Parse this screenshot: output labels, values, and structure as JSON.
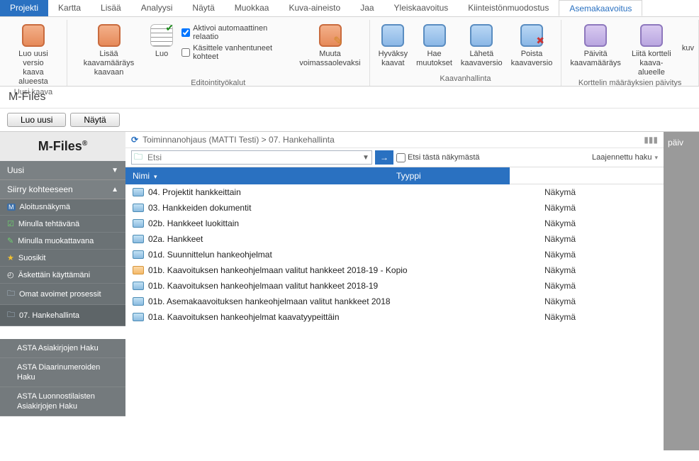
{
  "tabs": {
    "projekti": "Projekti",
    "kartta": "Kartta",
    "lisaa": "Lisää",
    "analyysi": "Analyysi",
    "nayta": "Näytä",
    "muokkaa": "Muokkaa",
    "kuva": "Kuva-aineisto",
    "jaa": "Jaa",
    "yleis": "Yleiskaavoitus",
    "kiint": "Kiinteistönmuodostus",
    "asema": "Asemakaavoitus"
  },
  "ribbon": {
    "group1_label": "Uusi kaava",
    "luo_uusi_versio": "Luo uusi versio\nkaava alueesta",
    "lisaa_maarays": "Lisää kaavamääräys\nkaavaan",
    "group2_label": "Editointityökalut",
    "luo": "Luo",
    "chk_aktivoi": "Aktivoi automaattinen relaatio",
    "chk_kasittele": "Käsittele vanhentuneet kohteet",
    "muuta": "Muuta\nvoimassaolevaksi",
    "group3_label": "Kaavanhallinta",
    "hyvaksy": "Hyväksy\nkaavat",
    "hae": "Hae\nmuutokset",
    "laheta": "Lähetä\nkaavaversio",
    "poista": "Poista\nkaavaversio",
    "group4_label": "Korttelin määräyksien päivitys",
    "paivita": "Päivitä\nkaavamääräys",
    "liita": "Liitä kortteli\nkaava-alueelle",
    "kuv_partial": "kuv"
  },
  "mfiles": {
    "title": "M-Files",
    "luo_uusi_btn": "Luo uusi",
    "nayta_btn": "Näytä",
    "brand": "M-Files",
    "breadcrumb": "Toiminnanohjaus (MATTI Testi) > 07. Hankehallinta",
    "search_placeholder": "Etsi",
    "search_scope": "Etsi tästä näkymästä",
    "search_mode": "Laajennettu haku",
    "right_label": "päiv"
  },
  "sidebar": {
    "uusi": "Uusi",
    "siirry": "Siirry kohteeseen",
    "items": {
      "aloitus": "Aloitusnäkymä",
      "tehtavana": "Minulla tehtävänä",
      "muokattavana": "Minulla muokattavana",
      "suosikit": "Suosikit",
      "askettain": "Äskettäin käyttämäni",
      "omat": "Omat avoimet prosessit",
      "hanke": "07. Hankehallinta"
    },
    "extra": {
      "asta1": "ASTA Asiakirjojen Haku",
      "asta2": "ASTA Diaarinumeroiden Haku",
      "asta3": "ASTA Luonnostilaisten Asiakirjojen Haku"
    }
  },
  "cols": {
    "nimi": "Nimi",
    "tyyppi": "Tyyppi"
  },
  "rows": [
    {
      "name": "04. Projektit hankkeittain",
      "type": "Näkymä",
      "icon": "light"
    },
    {
      "name": "03. Hankkeiden dokumentit",
      "type": "Näkymä",
      "icon": "light"
    },
    {
      "name": "02b. Hankkeet luokittain",
      "type": "Näkymä",
      "icon": "light"
    },
    {
      "name": "02a. Hankkeet",
      "type": "Näkymä",
      "icon": "light"
    },
    {
      "name": "01d. Suunnittelun hankeohjelmat",
      "type": "Näkymä",
      "icon": "light"
    },
    {
      "name": "01b. Kaavoituksen hankeohjelmaan valitut hankkeet 2018-19 - Kopio",
      "type": "Näkymä",
      "icon": "orange"
    },
    {
      "name": "01b. Kaavoituksen hankeohjelmaan valitut hankkeet 2018-19",
      "type": "Näkymä",
      "icon": "light"
    },
    {
      "name": "01b. Asemakaavoituksen hankeohjelmaan valitut hankkeet 2018",
      "type": "Näkymä",
      "icon": "light"
    },
    {
      "name": "01a. Kaavoituksen hankeohjelmat kaavatyypeittäin",
      "type": "Näkymä",
      "icon": "light"
    }
  ]
}
